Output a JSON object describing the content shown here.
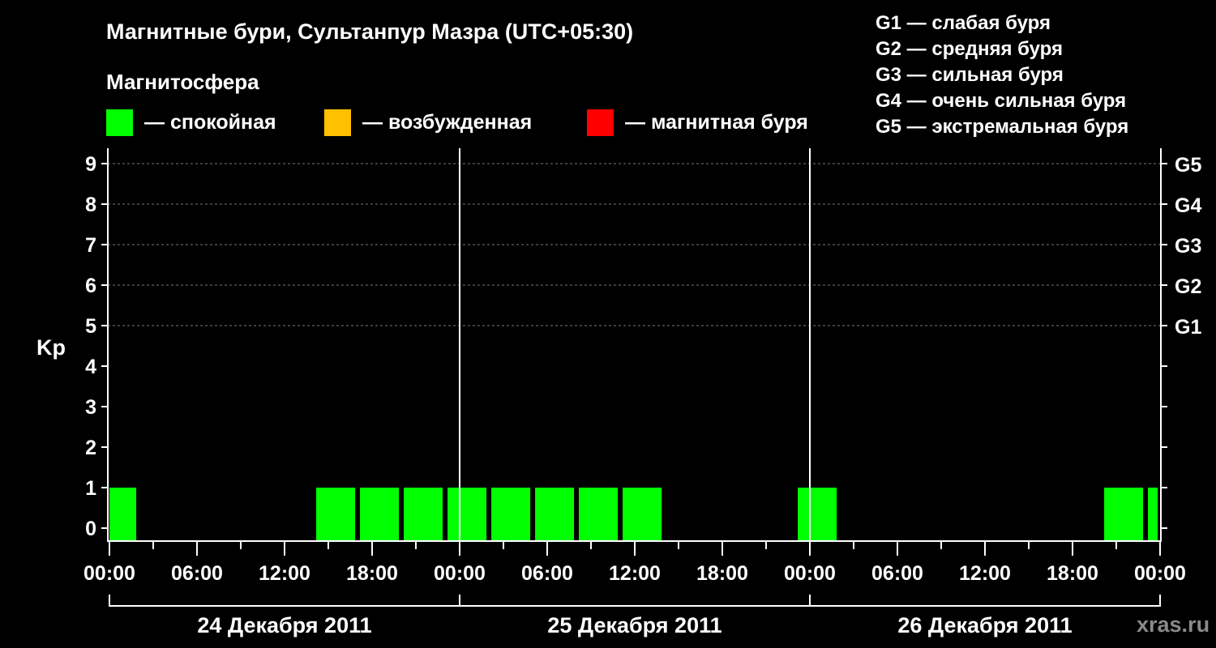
{
  "title": "Магнитные бури, Сультанпур Мазра (UTC+05:30)",
  "magnetosphere_label": "Магнитосфера",
  "legend": [
    {
      "label": "— спокойная",
      "color": "#00ff00"
    },
    {
      "label": "— возбужденная",
      "color": "#ffc000"
    },
    {
      "label": "— магнитная буря",
      "color": "#ff0000"
    }
  ],
  "g_scale": [
    "G1 — слабая буря",
    "G2 — средняя буря",
    "G3 — сильная буря",
    "G4 — очень сильная буря",
    "G5 — экстремальная буря"
  ],
  "watermark": "xras.ru",
  "chart_data": {
    "type": "bar",
    "ylabel": "Kp",
    "ylim": [
      0,
      9
    ],
    "yticks": [
      "0",
      "1",
      "2",
      "3",
      "4",
      "5",
      "6",
      "7",
      "8",
      "9"
    ],
    "right_ticks": [
      {
        "kp": 5,
        "label": "G1"
      },
      {
        "kp": 6,
        "label": "G2"
      },
      {
        "kp": 7,
        "label": "G3"
      },
      {
        "kp": 8,
        "label": "G4"
      },
      {
        "kp": 9,
        "label": "G5"
      }
    ],
    "x_range_hours": [
      0,
      72
    ],
    "xtick_labels": [
      "00:00",
      "06:00",
      "12:00",
      "18:00",
      "00:00",
      "06:00",
      "12:00",
      "18:00",
      "00:00",
      "06:00",
      "12:00",
      "18:00",
      "00:00"
    ],
    "days": [
      "24 Декабря 2011",
      "25 Декабря 2011",
      "26 Декабря 2011"
    ],
    "interval_hours": 3,
    "bars": [
      {
        "start_hour": -0.83,
        "kp": 1,
        "level": "спокойная"
      },
      {
        "start_hour": 14.17,
        "kp": 1,
        "level": "спокойная"
      },
      {
        "start_hour": 17.17,
        "kp": 1,
        "level": "спокойная"
      },
      {
        "start_hour": 20.17,
        "kp": 1,
        "level": "спокойная"
      },
      {
        "start_hour": 23.17,
        "kp": 1,
        "level": "спокойная"
      },
      {
        "start_hour": 26.17,
        "kp": 1,
        "level": "спокойная"
      },
      {
        "start_hour": 29.17,
        "kp": 1,
        "level": "спокойная"
      },
      {
        "start_hour": 32.17,
        "kp": 1,
        "level": "спокойная"
      },
      {
        "start_hour": 35.17,
        "kp": 1,
        "level": "спокойная"
      },
      {
        "start_hour": 47.17,
        "kp": 1,
        "level": "спокойная"
      },
      {
        "start_hour": 68.17,
        "kp": 1,
        "level": "спокойная"
      },
      {
        "start_hour": 71.17,
        "kp": 1,
        "level": "спокойная"
      }
    ]
  }
}
